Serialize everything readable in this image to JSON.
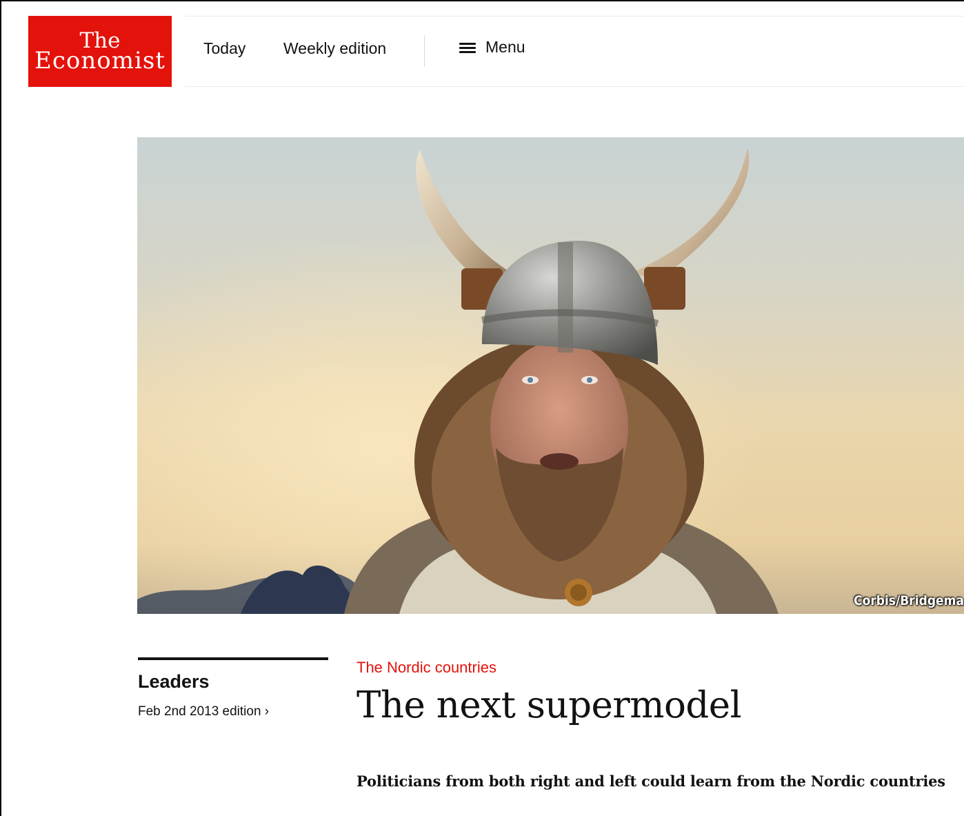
{
  "header": {
    "logo_line1": "The",
    "logo_line2": "Economist",
    "nav": {
      "today": "Today",
      "weekly_edition": "Weekly edition",
      "menu": "Menu",
      "menu_icon": "hamburger-icon"
    }
  },
  "hero": {
    "credit": "Corbis/Bridgema"
  },
  "sidebar": {
    "section": "Leaders",
    "edition": "Feb 2nd 2013 edition ›"
  },
  "article": {
    "flytitle": "The Nordic countries",
    "headline": "The next supermodel",
    "rubric": "Politicians from both right and left could learn from the Nordic countries"
  },
  "colors": {
    "brand_red": "#e3120b",
    "text": "#121212"
  }
}
